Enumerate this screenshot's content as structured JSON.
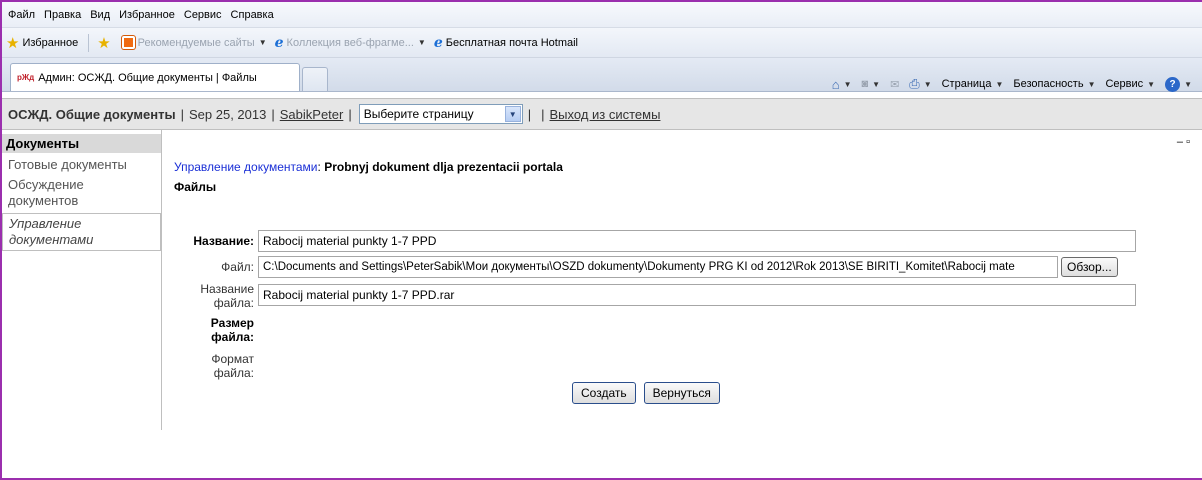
{
  "menu": [
    "Файл",
    "Правка",
    "Вид",
    "Избранное",
    "Сервис",
    "Справка"
  ],
  "favorites": {
    "label": "Избранное",
    "items": [
      "Рекомендуемые сайты",
      "Коллекция веб-фрагме...",
      "Бесплатная почта Hotmail"
    ]
  },
  "tab": {
    "logo": "рЖд",
    "title": "Админ: ОСЖД. Общие документы | Файлы"
  },
  "commands": {
    "page": "Страница",
    "security": "Безопасность",
    "service": "Сервис"
  },
  "header": {
    "title": "ОСЖД. Общие документы",
    "date": "Sep 25, 2013",
    "user": "SabikPeter",
    "select_value": "Выберите страницу",
    "logout": "Выход из системы"
  },
  "sidebar": {
    "heading": "Документы",
    "items": [
      "Готовые документы",
      "Обсуждение документов",
      "Управление документами"
    ]
  },
  "main": {
    "crumb_link": "Управление документами",
    "crumb_sep": ":",
    "crumb_title": "Probnyj dokument dlja prezentacii portala",
    "subtitle": "Файлы",
    "name_label": "Название:",
    "name_value": "Rabocij material punkty 1-7 PPD",
    "file_label": "Файл:",
    "file_value": "C:\\Documents and Settings\\PeterSabik\\Мои документы\\OSZD dokumenty\\Dokumenty PRG KI od 2012\\Rok 2013\\SE BIRITI_Komitet\\Rabocij mate",
    "browse": "Обзор...",
    "filename_label_1": "Название",
    "filename_label_2": "файла:",
    "filename_value": "Rabocij material punkty 1-7 PPD.rar",
    "size_label_1": "Размер",
    "size_label_2": "файла:",
    "format_label_1": "Формат",
    "format_label_2": "файла:",
    "create": "Создать",
    "back": "Вернуться"
  }
}
